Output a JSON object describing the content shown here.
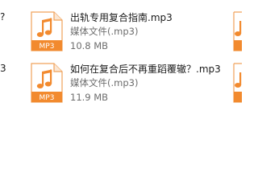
{
  "left_column_fragments": [
    "?",
    "3"
  ],
  "files": [
    {
      "name": "出轨专用复合指南.mp3",
      "type": "媒体文件(.mp3)",
      "size": "10.8 MB",
      "badge": "MP3",
      "icon": "mp3-music-note-icon"
    },
    {
      "name": "如何在复合后不再重蹈覆辙？.mp3",
      "type": "媒体文件(.mp3)",
      "size": "11.9 MB",
      "badge": "MP3",
      "icon": "mp3-music-note-icon"
    }
  ],
  "colors": {
    "accent": "#f28a2e",
    "icon_outline": "#f0a25a",
    "name_text": "#1a1a1a",
    "meta_text": "#6d6d6d"
  }
}
